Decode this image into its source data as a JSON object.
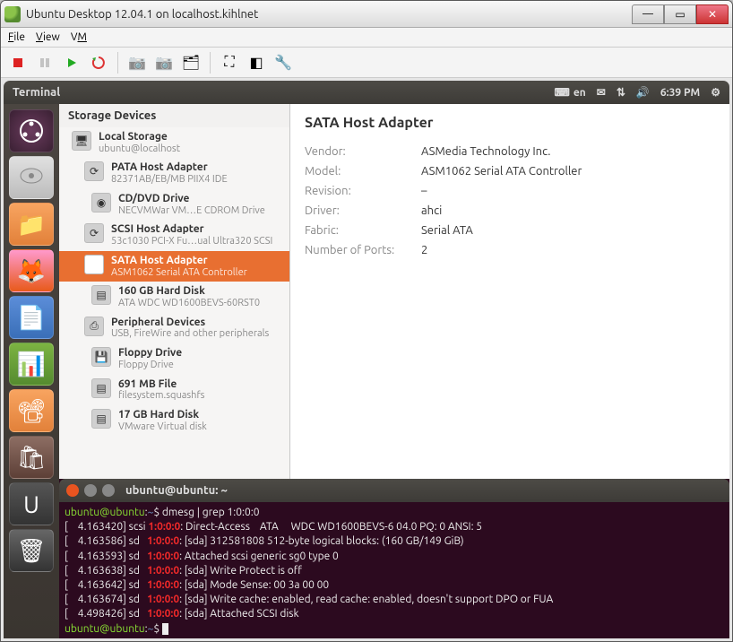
{
  "window": {
    "title": "Ubuntu Desktop 12.04.1 on localhost.kihlnet"
  },
  "menubar": {
    "file": "File",
    "view": "View",
    "vm": "VM"
  },
  "ubuntu_top": {
    "app": "Terminal",
    "lang": "en",
    "time": "6:39 PM"
  },
  "diskapp": {
    "left_header": "Storage Devices",
    "details_title": "SATA Host Adapter",
    "items": [
      {
        "title": "Local Storage",
        "sub": "ubuntu@localhost"
      },
      {
        "title": "PATA Host Adapter",
        "sub": "82371AB/EB/MB PIIX4 IDE"
      },
      {
        "title": "CD/DVD Drive",
        "sub": "NECVMWar VM…E CDROM Drive"
      },
      {
        "title": "SCSI Host Adapter",
        "sub": "53c1030 PCI-X Fu…ual Ultra320 SCSI"
      },
      {
        "title": "SATA Host Adapter",
        "sub": "ASM1062 Serial ATA Controller"
      },
      {
        "title": "160 GB Hard Disk",
        "sub": "ATA WDC WD1600BEVS-60RST0"
      },
      {
        "title": "Peripheral Devices",
        "sub": "USB, FireWire and other peripherals"
      },
      {
        "title": "Floppy Drive",
        "sub": "Floppy Drive"
      },
      {
        "title": "691 MB File",
        "sub": "filesystem.squashfs"
      },
      {
        "title": "17 GB Hard Disk",
        "sub": "VMware Virtual disk"
      }
    ],
    "props": {
      "vendor_k": "Vendor:",
      "vendor_v": "ASMedia Technology Inc.",
      "model_k": "Model:",
      "model_v": "ASM1062 Serial ATA Controller",
      "revision_k": "Revision:",
      "revision_v": "–",
      "driver_k": "Driver:",
      "driver_v": "ahci",
      "fabric_k": "Fabric:",
      "fabric_v": "Serial ATA",
      "ports_k": "Number of Ports:",
      "ports_v": "2"
    }
  },
  "terminal": {
    "title": "ubuntu@ubuntu: ~",
    "prompt_user": "ubuntu@ubuntu",
    "prompt_path": "~",
    "cmd": "dmesg | grep 1:0:0:0",
    "lines": [
      {
        "ts": "4.163420",
        "dev": "scsi",
        "msg": "Direct-Access    ATA     WDC WD1600BEVS-6 04.0 PQ: 0 ANSI: 5"
      },
      {
        "ts": "4.163586",
        "dev": "sd",
        "msg": "[sda] 312581808 512-byte logical blocks: (160 GB/149 GiB)"
      },
      {
        "ts": "4.163593",
        "dev": "sd",
        "msg": "Attached scsi generic sg0 type 0"
      },
      {
        "ts": "4.163638",
        "dev": "sd",
        "msg": "[sda] Write Protect is off"
      },
      {
        "ts": "4.163642",
        "dev": "sd",
        "msg": "[sda] Mode Sense: 00 3a 00 00"
      },
      {
        "ts": "4.163674",
        "dev": "sd",
        "msg": "[sda] Write cache: enabled, read cache: enabled, doesn't support DPO or FUA"
      },
      {
        "ts": "4.498426",
        "dev": "sd",
        "msg": "[sda] Attached SCSI disk"
      }
    ]
  }
}
